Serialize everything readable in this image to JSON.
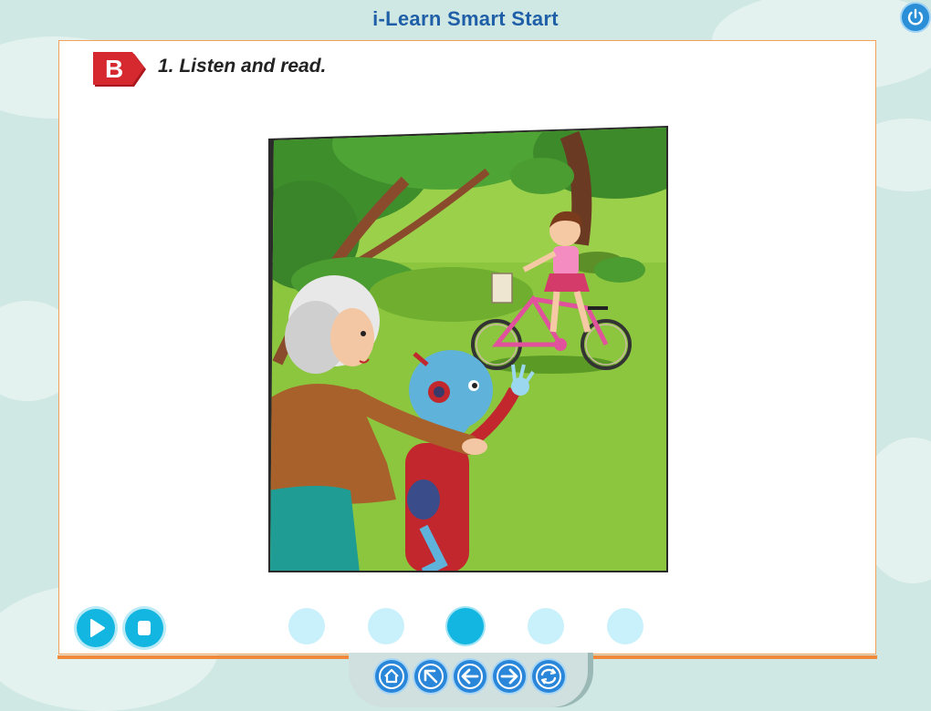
{
  "app": {
    "title": "i-Learn Smart Start"
  },
  "section": {
    "letter": "B",
    "instruction": "1. Listen and read."
  },
  "pager": {
    "count": 5,
    "active_index": 2
  },
  "icons": {
    "power": "power-icon",
    "play": "play-icon",
    "stop": "stop-icon",
    "home": "home-icon",
    "menu": "menu-arrow-icon",
    "back": "back-arrow-icon",
    "next": "next-arrow-icon",
    "refresh": "refresh-icon"
  },
  "colors": {
    "accent_blue": "#12b6e0",
    "nav_blue": "#2a86d8",
    "panel_border": "#f08a3a",
    "badge_red": "#d6292f",
    "title_blue": "#1f5fa8"
  }
}
